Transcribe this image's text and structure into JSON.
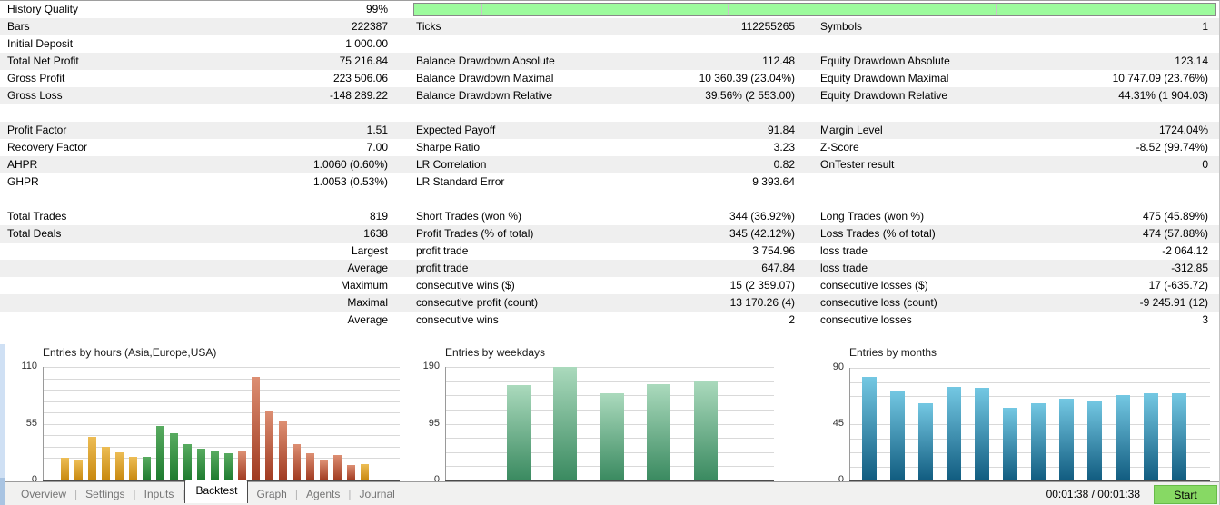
{
  "colors": {
    "row_stripe": "#efefef",
    "progress_fill": "#9dfb9d",
    "progress_border": "#898989",
    "start_button_fill": "#87d964",
    "bar_gradients": {
      "asia": {
        "top": "#edbd55",
        "bottom": "#c8880e"
      },
      "europe": {
        "top": "#58ab60",
        "bottom": "#1e7b2f"
      },
      "usa": {
        "top": "#dd8f73",
        "bottom": "#a03a20"
      },
      "weekday": {
        "top": "#abdabd",
        "bottom": "#3a8a60"
      },
      "month": {
        "top": "#74c8e3",
        "bottom": "#115c80"
      }
    }
  },
  "stats": {
    "rows": [
      {
        "stripe": false,
        "progress": true,
        "cells": [
          {
            "label": "History Quality",
            "value": "99%"
          },
          {
            "label": "",
            "value": ""
          },
          {
            "label": "",
            "value": ""
          }
        ]
      },
      {
        "stripe": true,
        "cells": [
          {
            "label": "Bars",
            "value": "222387"
          },
          {
            "label": "Ticks",
            "value": "112255265"
          },
          {
            "label": "Symbols",
            "value": "1"
          }
        ]
      },
      {
        "stripe": false,
        "cells": [
          {
            "label": "Initial Deposit",
            "value": "1 000.00"
          },
          {
            "label": "",
            "value": ""
          },
          {
            "label": "",
            "value": ""
          }
        ]
      },
      {
        "stripe": true,
        "cells": [
          {
            "label": "Total Net Profit",
            "value": "75 216.84"
          },
          {
            "label": "Balance Drawdown Absolute",
            "value": "112.48"
          },
          {
            "label": "Equity Drawdown Absolute",
            "value": "123.14"
          }
        ]
      },
      {
        "stripe": false,
        "cells": [
          {
            "label": "Gross Profit",
            "value": "223 506.06"
          },
          {
            "label": "Balance Drawdown Maximal",
            "value": "10 360.39 (23.04%)"
          },
          {
            "label": "Equity Drawdown Maximal",
            "value": "10 747.09 (23.76%)"
          }
        ]
      },
      {
        "stripe": true,
        "cells": [
          {
            "label": "Gross Loss",
            "value": "-148 289.22"
          },
          {
            "label": "Balance Drawdown Relative",
            "value": "39.56% (2 553.00)"
          },
          {
            "label": "Equity Drawdown Relative",
            "value": "44.31% (1 904.03)"
          }
        ]
      },
      {
        "stripe": false,
        "cells": [
          {
            "label": "",
            "value": ""
          },
          {
            "label": "",
            "value": ""
          },
          {
            "label": "",
            "value": ""
          }
        ]
      },
      {
        "stripe": true,
        "cells": [
          {
            "label": "Profit Factor",
            "value": "1.51"
          },
          {
            "label": "Expected Payoff",
            "value": "91.84"
          },
          {
            "label": "Margin Level",
            "value": "1724.04%"
          }
        ]
      },
      {
        "stripe": false,
        "cells": [
          {
            "label": "Recovery Factor",
            "value": "7.00"
          },
          {
            "label": "Sharpe Ratio",
            "value": "3.23"
          },
          {
            "label": "Z-Score",
            "value": "-8.52 (99.74%)"
          }
        ]
      },
      {
        "stripe": true,
        "cells": [
          {
            "label": "AHPR",
            "value": "1.0060 (0.60%)"
          },
          {
            "label": "LR Correlation",
            "value": "0.82"
          },
          {
            "label": "OnTester result",
            "value": "0"
          }
        ]
      },
      {
        "stripe": false,
        "cells": [
          {
            "label": "GHPR",
            "value": "1.0053 (0.53%)"
          },
          {
            "label": "LR Standard Error",
            "value": "9 393.64"
          },
          {
            "label": "",
            "value": ""
          }
        ]
      },
      {
        "stripe": false,
        "cells": [
          {
            "label": "",
            "value": ""
          },
          {
            "label": "",
            "value": ""
          },
          {
            "label": "",
            "value": ""
          }
        ]
      },
      {
        "stripe": false,
        "cells": [
          {
            "label": "Total Trades",
            "value": "819"
          },
          {
            "label": "Short Trades (won %)",
            "value": "344 (36.92%)"
          },
          {
            "label": "Long Trades (won %)",
            "value": "475 (45.89%)"
          }
        ]
      },
      {
        "stripe": true,
        "cells": [
          {
            "label": "Total Deals",
            "value": "1638"
          },
          {
            "label": "Profit Trades (% of total)",
            "value": "345 (42.12%)"
          },
          {
            "label": "Loss Trades (% of total)",
            "value": "474 (57.88%)"
          }
        ]
      },
      {
        "stripe": false,
        "cells": [
          {
            "label": "",
            "value": "Largest"
          },
          {
            "label": "profit trade",
            "value": "3 754.96"
          },
          {
            "label": "loss trade",
            "value": "-2 064.12"
          }
        ]
      },
      {
        "stripe": true,
        "cells": [
          {
            "label": "",
            "value": "Average"
          },
          {
            "label": "profit trade",
            "value": "647.84"
          },
          {
            "label": "loss trade",
            "value": "-312.85"
          }
        ]
      },
      {
        "stripe": false,
        "cells": [
          {
            "label": "",
            "value": "Maximum"
          },
          {
            "label": "consecutive wins ($)",
            "value": "15 (2 359.07)"
          },
          {
            "label": "consecutive losses ($)",
            "value": "17 (-635.72)"
          }
        ]
      },
      {
        "stripe": true,
        "cells": [
          {
            "label": "",
            "value": "Maximal"
          },
          {
            "label": "consecutive profit (count)",
            "value": "13 170.26 (4)"
          },
          {
            "label": "consecutive loss (count)",
            "value": "-9 245.91 (12)"
          }
        ]
      },
      {
        "stripe": false,
        "cells": [
          {
            "label": "",
            "value": "Average"
          },
          {
            "label": "consecutive wins",
            "value": "2"
          },
          {
            "label": "consecutive losses",
            "value": "3"
          }
        ]
      }
    ]
  },
  "chart_data": [
    {
      "type": "bar",
      "title": "Entries by hours (Asia,Europe,USA)",
      "x": [
        0,
        1,
        2,
        3,
        4,
        5,
        6,
        7,
        8,
        9,
        10,
        11,
        12,
        13,
        14,
        15,
        16,
        17,
        18,
        19,
        20,
        21,
        22,
        23
      ],
      "values": [
        0,
        22,
        19,
        42,
        33,
        27,
        23,
        23,
        53,
        46,
        35,
        31,
        28,
        26,
        28,
        100,
        68,
        57,
        35,
        26,
        19,
        25,
        15,
        16
      ],
      "sessions": [
        "none",
        "asia",
        "asia",
        "asia",
        "asia",
        "asia",
        "asia",
        "europe",
        "europe",
        "europe",
        "europe",
        "europe",
        "europe",
        "europe",
        "usa",
        "usa",
        "usa",
        "usa",
        "usa",
        "usa",
        "usa",
        "usa",
        "usa",
        "asia"
      ],
      "ylim": [
        0,
        110
      ],
      "yticks": [
        "110",
        "55",
        "0"
      ],
      "grid": true,
      "legend_position": "none"
    },
    {
      "type": "bar",
      "title": "Entries by weekdays",
      "values": [
        160,
        190,
        146,
        161,
        167
      ],
      "ylim": [
        0,
        190
      ],
      "yticks": [
        "190",
        "95",
        "0"
      ],
      "grid": true,
      "legend_position": "none"
    },
    {
      "type": "bar",
      "title": "Entries by months",
      "values": [
        83,
        72,
        62,
        75,
        74,
        58,
        62,
        65,
        64,
        68,
        70,
        70
      ],
      "ylim": [
        0,
        90
      ],
      "yticks": [
        "90",
        "45",
        "0"
      ],
      "grid": true,
      "legend_position": "none"
    }
  ],
  "tabs": {
    "items": [
      "Overview",
      "Settings",
      "Inputs",
      "Backtest",
      "Graph",
      "Agents",
      "Journal"
    ],
    "active": "Backtest"
  },
  "status": {
    "time": "00:01:38 / 00:01:38",
    "start_label": "Start"
  }
}
